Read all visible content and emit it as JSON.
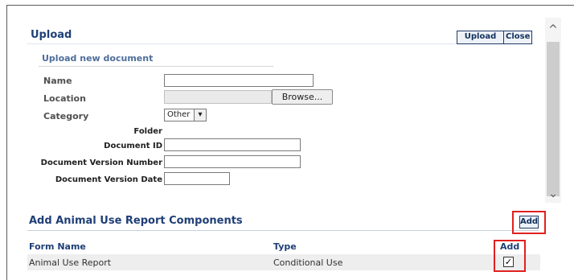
{
  "upload": {
    "title": "Upload",
    "upload_button": "Upload",
    "close_button": "Close",
    "subheading": "Upload new document"
  },
  "form": {
    "name_label": "Name",
    "name_value": "",
    "location_label": "Location",
    "browse_label": "Browse...",
    "category_label": "Category",
    "category_selected": "Other",
    "folder_label": "Folder",
    "document_id_label": "Document ID",
    "document_id_value": "",
    "version_number_label": "Document Version Number",
    "version_number_value": "",
    "version_date_label": "Document Version Date",
    "version_date_value": ""
  },
  "components": {
    "title": "Add Animal Use Report  Components",
    "add_button": "Add",
    "columns": [
      "Form Name",
      "Type",
      "Add"
    ],
    "rows": [
      {
        "form_name": "Animal Use Report",
        "type": "Conditional Use",
        "checked": true,
        "check_mark": "✓"
      }
    ]
  },
  "icons": {
    "scroll_up": "^",
    "scroll_down": "⌄",
    "dropdown_arrow": "▾"
  },
  "colors": {
    "heading": "#1f3f77",
    "highlight": "#e02020"
  }
}
